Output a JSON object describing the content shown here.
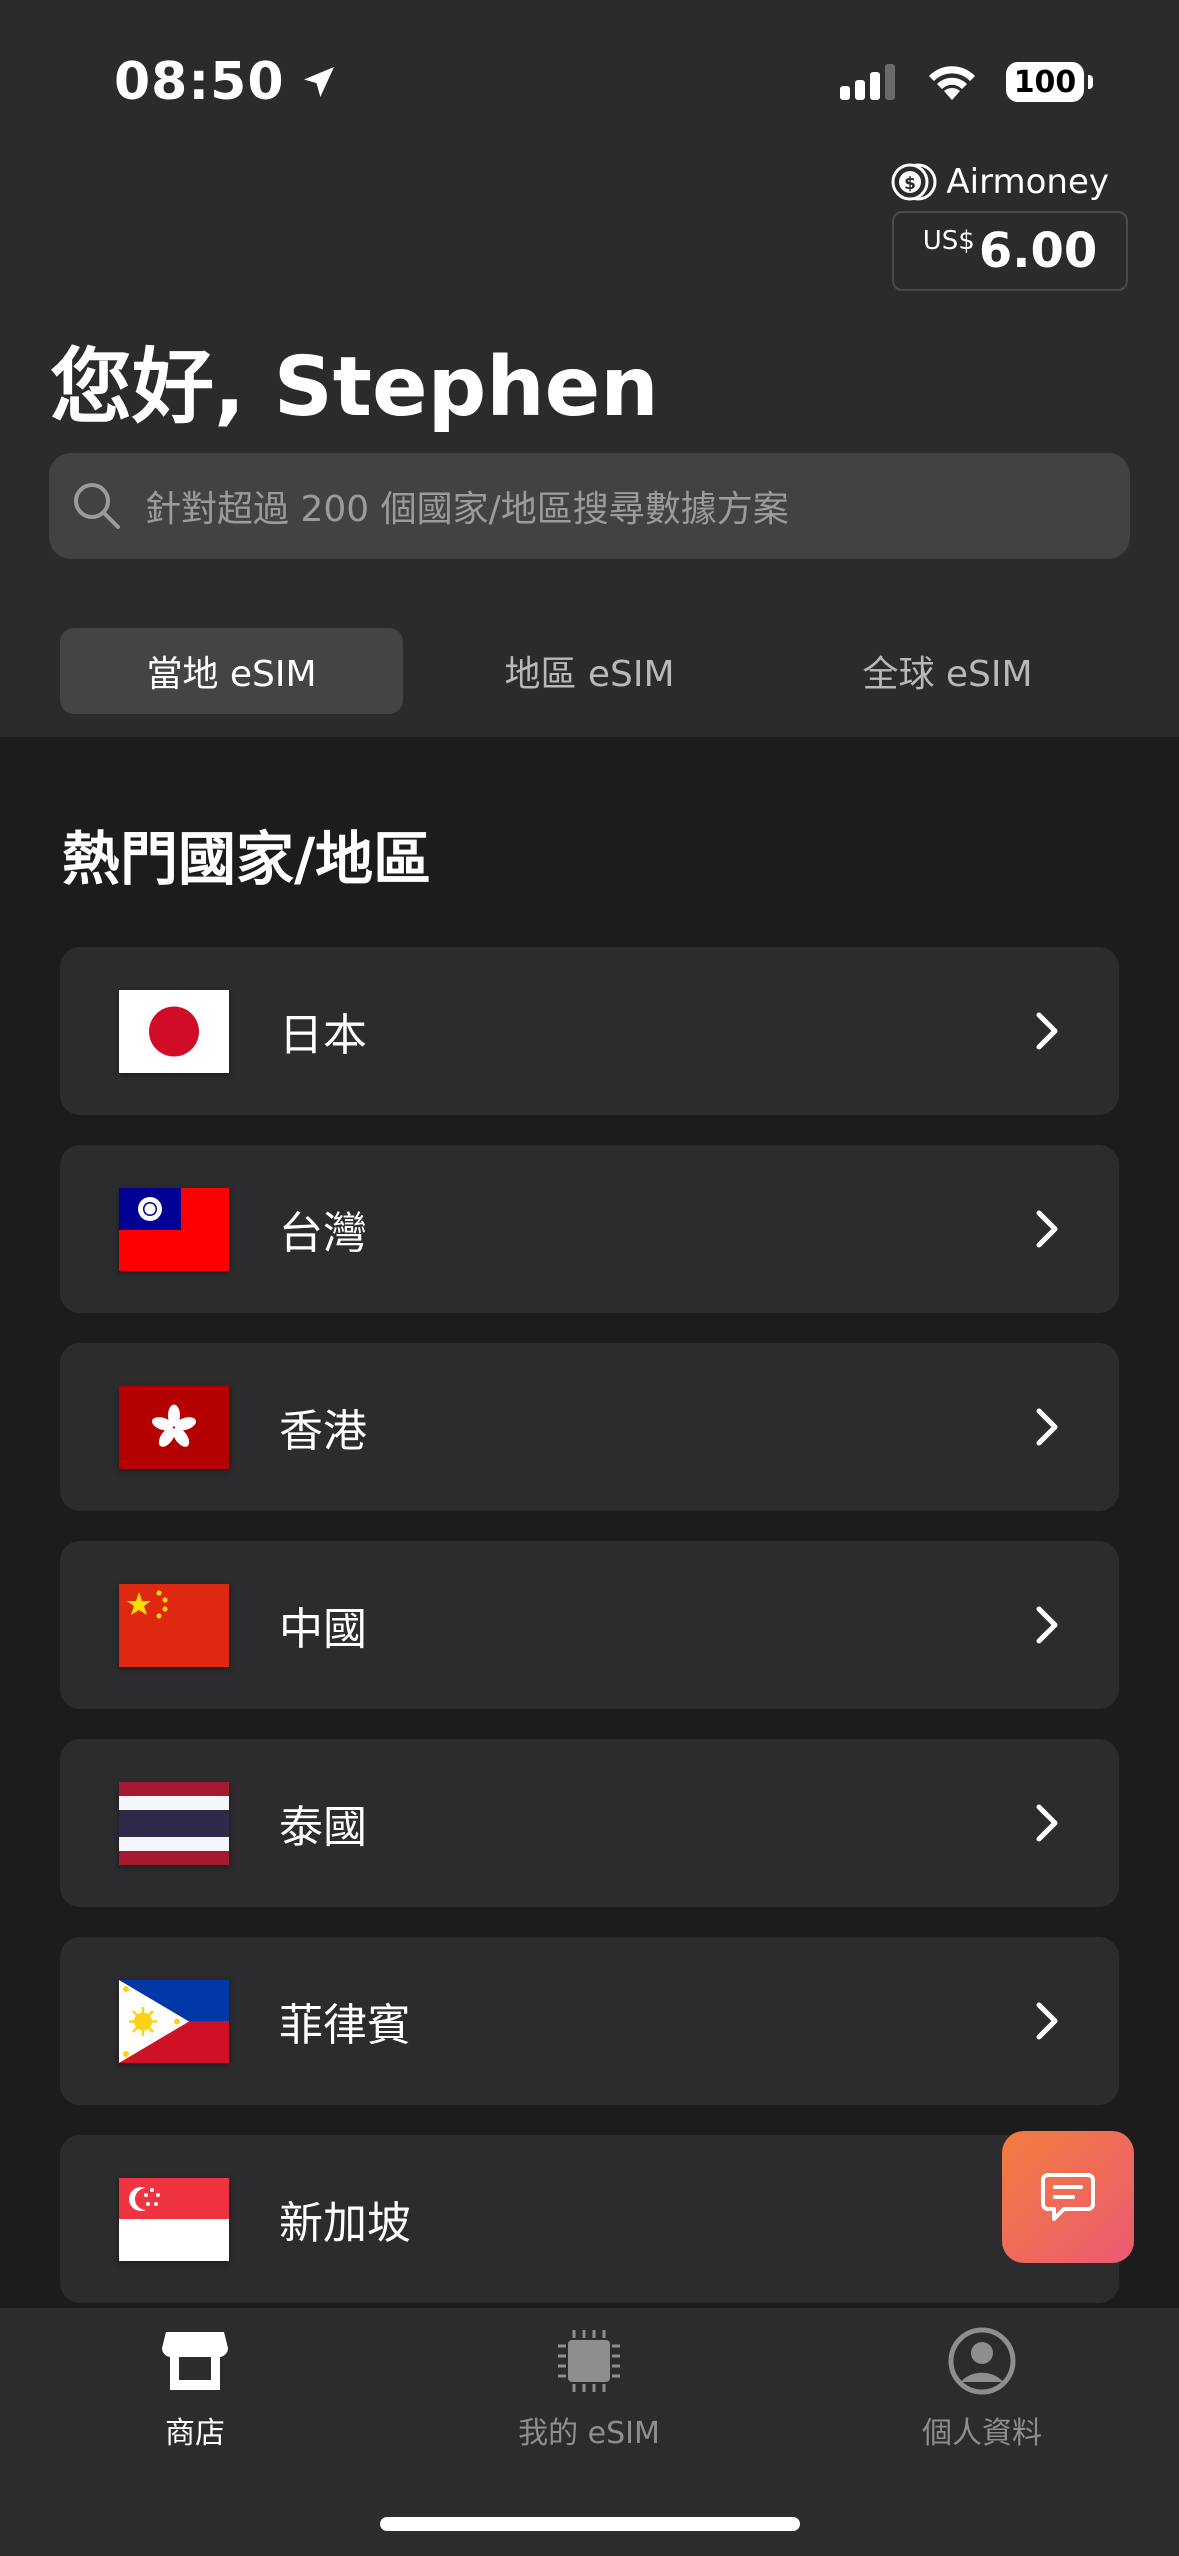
{
  "status_bar": {
    "time": "08:50",
    "battery": "100"
  },
  "wallet": {
    "label": "Airmoney",
    "currency": "US$",
    "amount": "6.00"
  },
  "greeting": "您好, Stephen",
  "search": {
    "placeholder": "針對超過 200 個國家/地區搜尋數據方案"
  },
  "tabs": [
    {
      "label": "當地 eSIM",
      "active": true
    },
    {
      "label": "地區 eSIM",
      "active": false
    },
    {
      "label": "全球 eSIM",
      "active": false
    }
  ],
  "section_title": "熱門國家/地區",
  "countries": [
    {
      "name": "日本",
      "flag": "japan-flag-icon"
    },
    {
      "name": "台灣",
      "flag": "taiwan-flag-icon"
    },
    {
      "name": "香港",
      "flag": "hong-kong-flag-icon"
    },
    {
      "name": "中國",
      "flag": "china-flag-icon"
    },
    {
      "name": "泰國",
      "flag": "thailand-flag-icon"
    },
    {
      "name": "菲律賓",
      "flag": "philippines-flag-icon"
    },
    {
      "name": "新加坡",
      "flag": "singapore-flag-icon"
    }
  ],
  "bottom_nav": [
    {
      "label": "商店",
      "icon": "store-icon",
      "active": true
    },
    {
      "label": "我的 eSIM",
      "icon": "sim-chip-icon",
      "active": false
    },
    {
      "label": "個人資料",
      "icon": "profile-icon",
      "active": false
    }
  ],
  "colors": {
    "header_bg": "#2b2b2c",
    "body_bg": "#1c1c1d",
    "card_bg": "#2c2c2e",
    "chat_gradient_start": "#f17d3f",
    "chat_gradient_end": "#ec5a72",
    "inactive_nav": "#8e8e90"
  }
}
